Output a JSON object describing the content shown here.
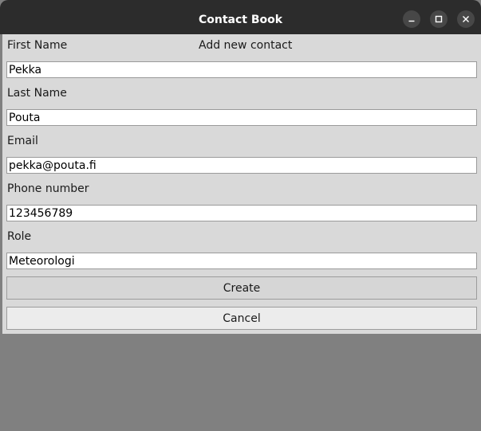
{
  "window": {
    "title": "Contact Book",
    "controls": {
      "minimize_icon": "minimize-icon",
      "maximize_icon": "maximize-icon",
      "close_icon": "close-icon"
    }
  },
  "form": {
    "heading": "Add new contact",
    "fields": [
      {
        "label": "First Name",
        "value": "Pekka"
      },
      {
        "label": "Last Name",
        "value": "Pouta"
      },
      {
        "label": "Email",
        "value": "pekka@pouta.fi"
      },
      {
        "label": "Phone number",
        "value": "123456789"
      },
      {
        "label": "Role",
        "value": "Meteorologi"
      }
    ],
    "create_label": "Create",
    "cancel_label": "Cancel"
  },
  "colors": {
    "titlebar": "#2c2c2c",
    "window_background": "#d9d9d9",
    "desktop_background": "#808080"
  }
}
